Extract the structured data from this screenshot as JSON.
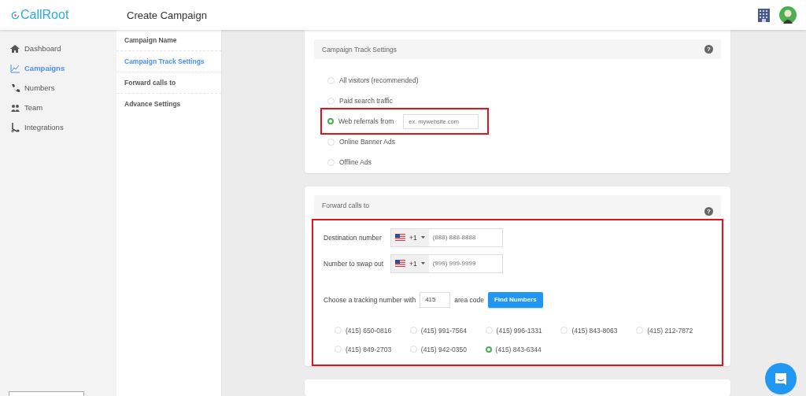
{
  "header": {
    "logo": "CallRoot",
    "title": "Create Campaign"
  },
  "sidebar": {
    "items": [
      {
        "label": "Dashboard",
        "selected": false
      },
      {
        "label": "Campaigns",
        "selected": true
      },
      {
        "label": "Numbers",
        "selected": false
      },
      {
        "label": "Team",
        "selected": false
      },
      {
        "label": "Integrations",
        "selected": false
      }
    ]
  },
  "steps": {
    "items": [
      {
        "label": "Campaign Name",
        "selected": false
      },
      {
        "label": "Campaign Track Settings",
        "selected": true
      },
      {
        "label": "Forward calls to",
        "selected": false
      },
      {
        "label": "Advance Settings",
        "selected": false
      }
    ]
  },
  "track_settings": {
    "title": "Campaign Track Settings",
    "help": "?",
    "options": [
      {
        "label": "All visitors (recommended)",
        "selected": false,
        "kind": "plain"
      },
      {
        "label": "Paid search traffic",
        "selected": false,
        "kind": "plain"
      },
      {
        "label": "Web referrals from",
        "selected": true,
        "kind": "input",
        "placeholder": "ex. mywebsite.com"
      },
      {
        "label": "Online Banner Ads",
        "selected": false,
        "kind": "plain"
      },
      {
        "label": "Offline Ads",
        "selected": false,
        "kind": "plain"
      }
    ]
  },
  "forward_calls": {
    "title": "Forward calls to",
    "help": "?",
    "phones": [
      {
        "label": "Destination number",
        "code": "+1",
        "placeholder": "(888) 888-8888"
      },
      {
        "label": "Number to swap out",
        "code": "+1",
        "placeholder": "(999) 999-9999"
      }
    ],
    "tracking": {
      "before": "Choose a tracking number with",
      "area_code": "415",
      "after": "area code",
      "button": "Find Numbers"
    },
    "numbers": [
      {
        "label": "(415) 650-0816",
        "selected": false
      },
      {
        "label": "(415) 991-7564",
        "selected": false
      },
      {
        "label": "(415) 996-1331",
        "selected": false
      },
      {
        "label": "(415) 843-8063",
        "selected": false
      },
      {
        "label": "(415) 212-7872",
        "selected": false
      },
      {
        "label": "(415) 849-2703",
        "selected": false
      },
      {
        "label": "(415) 942-0350",
        "selected": false
      },
      {
        "label": "(415) 843-6344",
        "selected": true
      }
    ]
  }
}
